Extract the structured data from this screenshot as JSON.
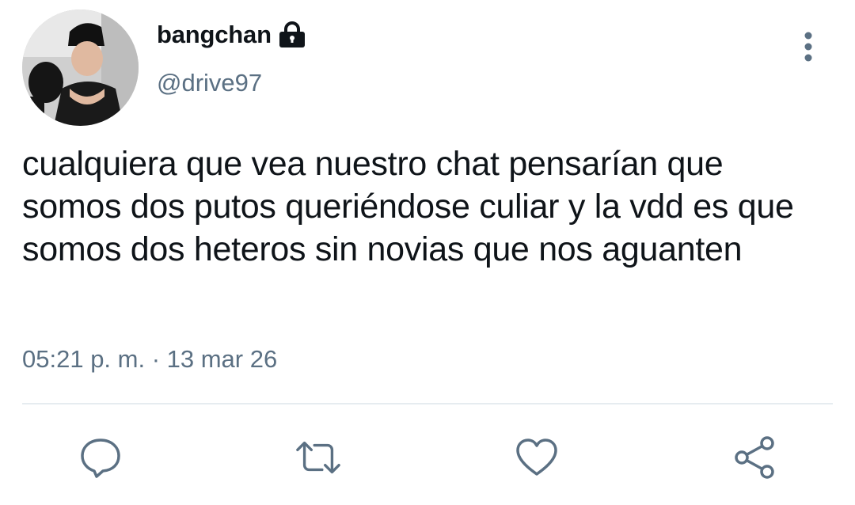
{
  "user": {
    "display_name": "bangchan",
    "handle": "@drive97",
    "protected": true,
    "avatar_icon": "avatar-photo"
  },
  "tweet": {
    "text": "cualquiera que vea nuestro chat pensarían que somos dos putos queriéndose culiar y la vdd es que somos dos heteros sin novias que nos aguanten",
    "timestamp": "05:21 p. m. · 13 mar 26"
  },
  "actions": [
    {
      "name": "reply",
      "icon": "comment-icon"
    },
    {
      "name": "retweet",
      "icon": "retweet-icon"
    },
    {
      "name": "like",
      "icon": "heart-icon"
    },
    {
      "name": "share",
      "icon": "share-icon"
    }
  ],
  "colors": {
    "text_primary": "#0f1419",
    "text_secondary": "#5b7083",
    "icon": "#5b7083",
    "divider": "#e6ecf0"
  }
}
